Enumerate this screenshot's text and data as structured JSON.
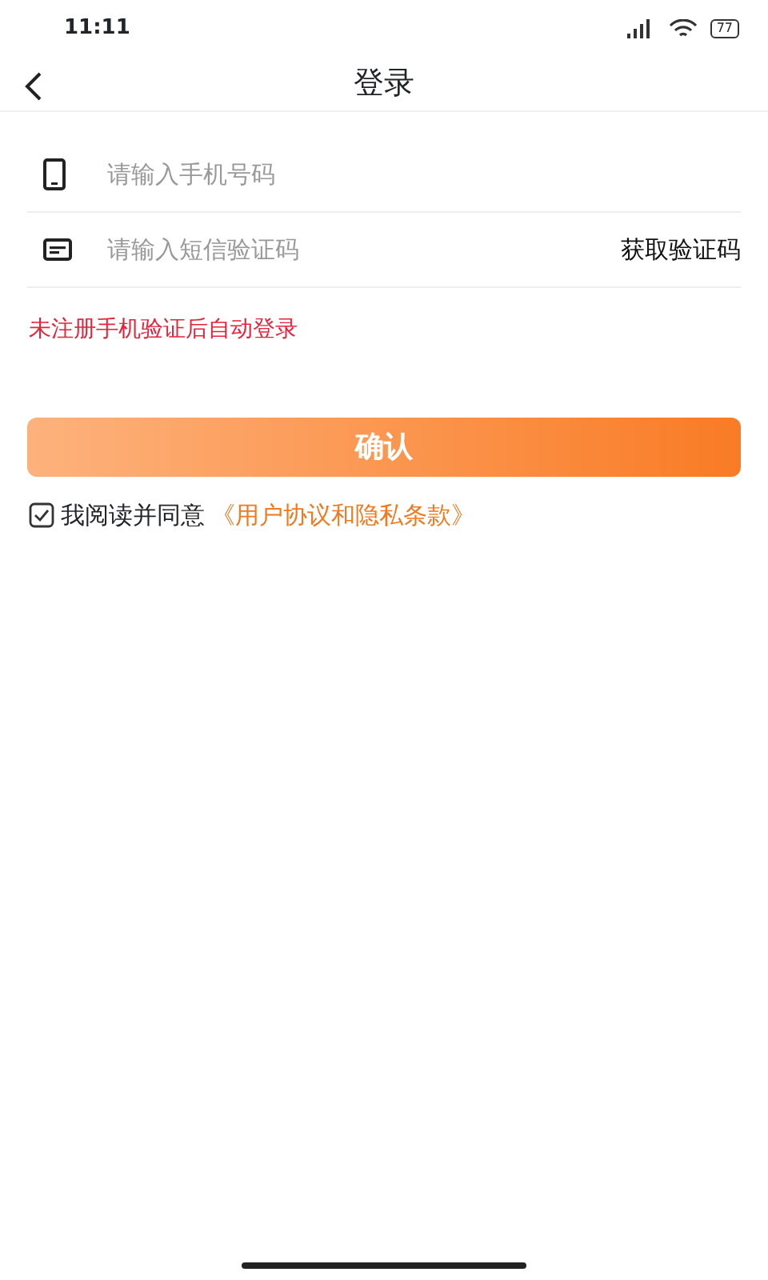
{
  "status_bar": {
    "time": "11:11",
    "battery": "77"
  },
  "nav": {
    "title": "登录"
  },
  "fields": [
    {
      "kind": "phone",
      "placeholder": "请输入手机号码"
    },
    {
      "kind": "sms",
      "placeholder": "请输入短信验证码",
      "action": "获取验证码"
    }
  ],
  "notice": "未注册手机验证后自动登录",
  "confirm_button": "确认",
  "agreement": {
    "checked": true,
    "text": "我阅读并同意",
    "link": "《用户协议和隐私条款》"
  }
}
